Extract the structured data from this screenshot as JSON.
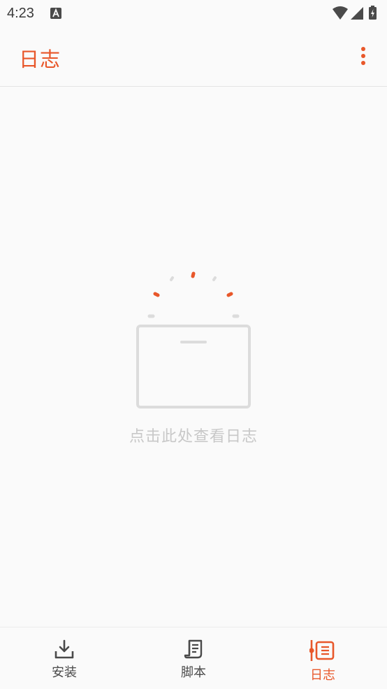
{
  "status_bar": {
    "time": "4:23",
    "icons": [
      "a-notification-icon",
      "wifi-icon",
      "signal-icon",
      "battery-charging-icon"
    ]
  },
  "app_bar": {
    "title": "日志",
    "menu_icon": "more-vert-icon"
  },
  "empty_state": {
    "hint": "点击此处查看日志",
    "icon": "empty-box-icon"
  },
  "bottom_nav": {
    "items": [
      {
        "label": "安装",
        "icon": "download-icon",
        "active": false
      },
      {
        "label": "脚本",
        "icon": "script-icon",
        "active": false
      },
      {
        "label": "日志",
        "icon": "log-icon",
        "active": true
      }
    ]
  },
  "colors": {
    "accent": "#e8572a",
    "nav_inactive": "#4a4a4a",
    "placeholder": "#c8c8c8",
    "background": "#fafafa"
  }
}
